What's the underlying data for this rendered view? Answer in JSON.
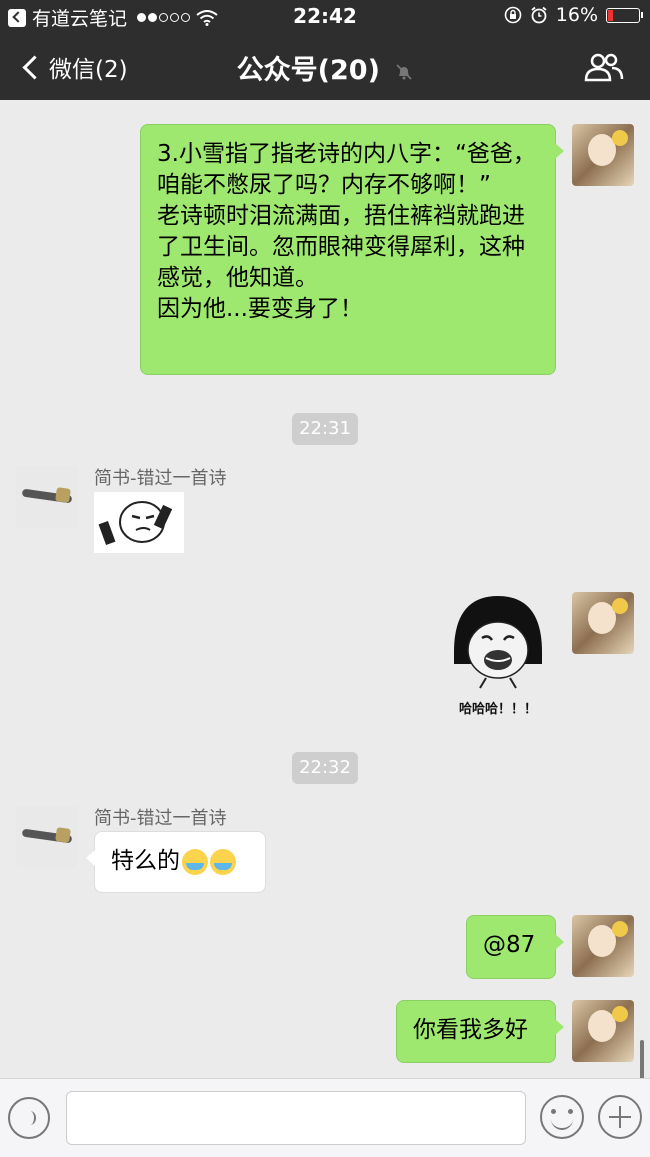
{
  "status_bar": {
    "back_app": "有道云笔记",
    "time": "22:42",
    "battery": "16%",
    "battery_level": 0.16,
    "icons": [
      "wifi-icon",
      "lock-rotation-icon",
      "alarm-icon",
      "battery-icon"
    ]
  },
  "nav": {
    "back_label": "微信(2)",
    "title": "公众号(20)",
    "icons": [
      "chevron-left-icon",
      "mute-icon",
      "group-members-icon"
    ]
  },
  "messages": {
    "m1": {
      "text": "3.小雪指了指老诗的内八字：“爸爸，咱能不憋尿了吗？内存不够啊！”\n老诗顿时泪流满面，捂住裤裆就跑进了卫生间。忽而眼神变得犀利，这种感觉，他知道。\n因为他...要变身了！"
    },
    "time1": "22:31",
    "m2": {
      "sender": "简书-错过一首诗"
    },
    "m3": {
      "sticker_caption": "哈哈哈！！！"
    },
    "time2": "22:32",
    "m4": {
      "sender": "简书-错过一首诗",
      "text": "特么的",
      "emoji": [
        "crying-laughing-emoji",
        "crying-laughing-emoji"
      ]
    },
    "m5": {
      "text": "@87"
    },
    "m6": {
      "text": "你看我多好"
    }
  },
  "input_bar": {
    "icons": [
      "voice-icon",
      "emoji-icon",
      "plus-icon"
    ],
    "value": ""
  }
}
